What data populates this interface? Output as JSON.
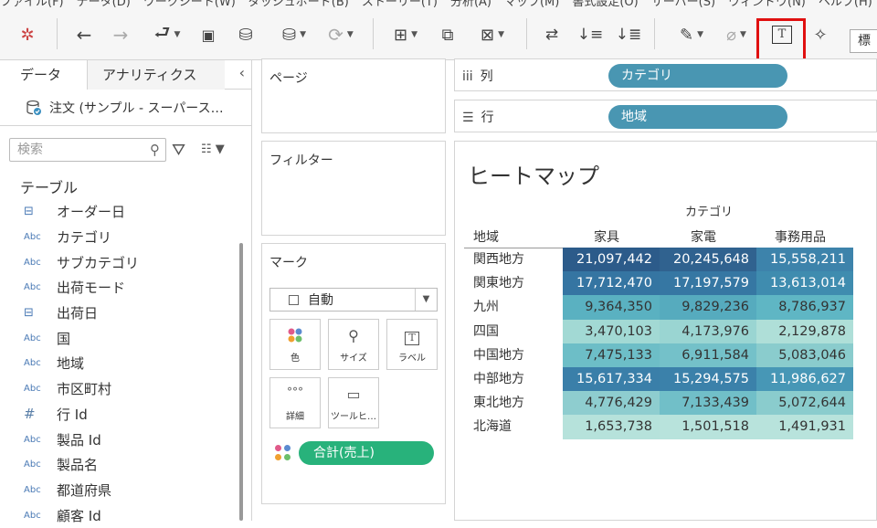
{
  "menu": {
    "items": [
      "ファイル(F)",
      "データ(D)",
      "ワークシート(W)",
      "ダッシュボード(B)",
      "ストーリー(T)",
      "分析(A)",
      "マップ(M)",
      "書式設定(O)",
      "サーバー(S)",
      "ウィンドウ(N)",
      "ヘルプ(H)"
    ]
  },
  "toolbar": {
    "standard_label": "標"
  },
  "datapane": {
    "tab_data": "データ",
    "tab_analytics": "アナリティクス",
    "datasource": "注文 (サンプル - スーパース…",
    "search_placeholder": "検索",
    "section": "テーブル",
    "fields": [
      {
        "type": "cal",
        "icon": "⊟",
        "name": "オーダー日"
      },
      {
        "type": "abc",
        "icon": "Abc",
        "name": "カテゴリ"
      },
      {
        "type": "abc",
        "icon": "Abc",
        "name": "サブカテゴリ"
      },
      {
        "type": "abc",
        "icon": "Abc",
        "name": "出荷モード"
      },
      {
        "type": "cal",
        "icon": "⊟",
        "name": "出荷日"
      },
      {
        "type": "abc",
        "icon": "Abc",
        "name": "国"
      },
      {
        "type": "abc",
        "icon": "Abc",
        "name": "地域"
      },
      {
        "type": "abc",
        "icon": "Abc",
        "name": "市区町村"
      },
      {
        "type": "num",
        "icon": "#",
        "name": "行 Id"
      },
      {
        "type": "abc",
        "icon": "Abc",
        "name": "製品 Id"
      },
      {
        "type": "abc",
        "icon": "Abc",
        "name": "製品名"
      },
      {
        "type": "abc",
        "icon": "Abc",
        "name": "都道府県"
      },
      {
        "type": "abc",
        "icon": "Abc",
        "name": "顧客 Id"
      }
    ]
  },
  "shelves": {
    "pages": "ページ",
    "filters": "フィルター",
    "marks": "マーク",
    "mark_type": "自動",
    "color": "色",
    "size": "サイズ",
    "label": "ラベル",
    "detail": "詳細",
    "tooltip": "ツールヒ…",
    "measure_pill": "合計(売上)",
    "columns_label": "列",
    "rows_label": "行",
    "columns_pill": "カテゴリ",
    "rows_pill": "地域"
  },
  "viz": {
    "title": "ヒートマップ",
    "column_field": "カテゴリ",
    "row_field": "地域",
    "columns": [
      "家具",
      "家電",
      "事務用品"
    ],
    "rows": [
      {
        "region": "関西地方",
        "values": [
          "21,097,442",
          "20,245,648",
          "15,558,211"
        ],
        "colors": [
          "#2c5b8a",
          "#30628f",
          "#3d83ab"
        ]
      },
      {
        "region": "関東地方",
        "values": [
          "17,712,470",
          "17,197,579",
          "13,613,014"
        ],
        "colors": [
          "#3575a2",
          "#3677a3",
          "#3f8caf"
        ]
      },
      {
        "region": "九州",
        "values": [
          "9,364,350",
          "9,829,236",
          "8,786,937"
        ],
        "colors": [
          "#5ab1c1",
          "#56abbe",
          "#5fb6c4"
        ]
      },
      {
        "region": "四国",
        "values": [
          "3,470,103",
          "4,173,976",
          "2,129,878"
        ],
        "colors": [
          "#a2d9d4",
          "#9ad5d2",
          "#afdfd8"
        ]
      },
      {
        "region": "中国地方",
        "values": [
          "7,475,133",
          "6,911,584",
          "5,083,046"
        ],
        "colors": [
          "#6dbec7",
          "#74c1c9",
          "#8acccd"
        ]
      },
      {
        "region": "中部地方",
        "values": [
          "15,617,334",
          "15,294,575",
          "11,986,627"
        ],
        "colors": [
          "#3a7fa9",
          "#3b81aa",
          "#4797b6"
        ]
      },
      {
        "region": "東北地方",
        "values": [
          "4,776,429",
          "7,133,439",
          "5,072,644"
        ],
        "colors": [
          "#8ecdcf",
          "#71bfc8",
          "#8acccd"
        ]
      },
      {
        "region": "北海道",
        "values": [
          "1,653,738",
          "1,501,518",
          "1,491,931"
        ],
        "colors": [
          "#b6e2db",
          "#b8e3dc",
          "#b8e3dc"
        ]
      }
    ]
  }
}
